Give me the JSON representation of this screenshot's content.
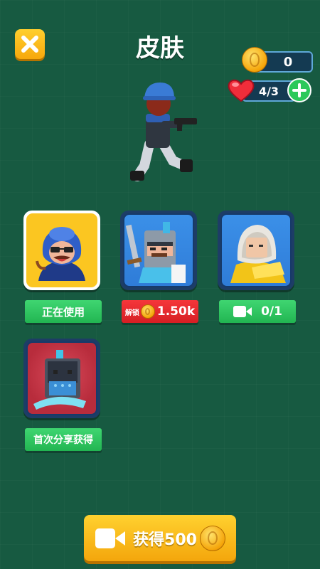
{
  "header": {
    "title": "皮肤"
  },
  "currency": {
    "coins": "0"
  },
  "lives": {
    "value": "4/3"
  },
  "skins": [
    {
      "tag_label": "正在使用"
    },
    {
      "tag_prefix": "解锁",
      "tag_label": "1.50k"
    },
    {
      "tag_label": "0/1"
    },
    {
      "tag_label": "首次分享获得"
    }
  ],
  "footer": {
    "button_label": "获得500"
  },
  "icons": {
    "close": "close-x-icon",
    "coin": "coin-icon",
    "heart": "heart-icon",
    "add": "plus-icon",
    "video": "video-camera-icon"
  },
  "colors": {
    "background": "#175a41",
    "accent_yellow": "#f7b318",
    "tag_green": "#2dbd5c",
    "tag_red": "#e4262b"
  }
}
